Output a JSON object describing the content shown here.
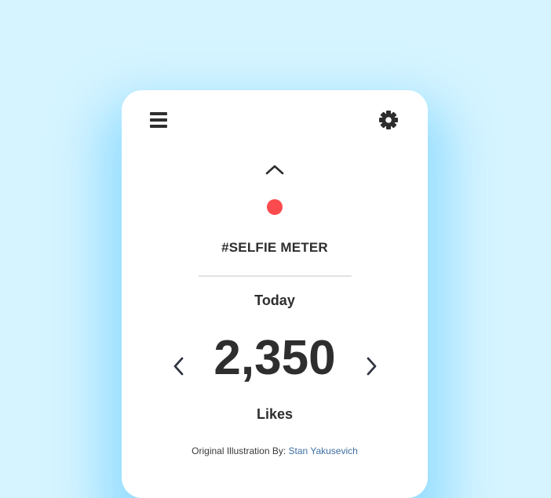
{
  "header": {
    "menu_icon": "hamburger-menu-icon",
    "settings_icon": "gear-icon"
  },
  "meter": {
    "up_icon": "chevron-up-icon",
    "indicator_color": "#fb4b4e",
    "title": "#SELFIE METER",
    "period": "Today",
    "count": "2,350",
    "unit": "Likes",
    "prev_icon": "chevron-left-icon",
    "next_icon": "chevron-right-icon"
  },
  "footer": {
    "credit_prefix": "Original Illustration By: ",
    "credit_author": "Stan Yakusevich"
  },
  "colors": {
    "background": "#d5f4ff",
    "card": "#ffffff",
    "text": "#2e2e2e",
    "accent_red": "#fb4b4e",
    "link": "#3f6fa3"
  }
}
